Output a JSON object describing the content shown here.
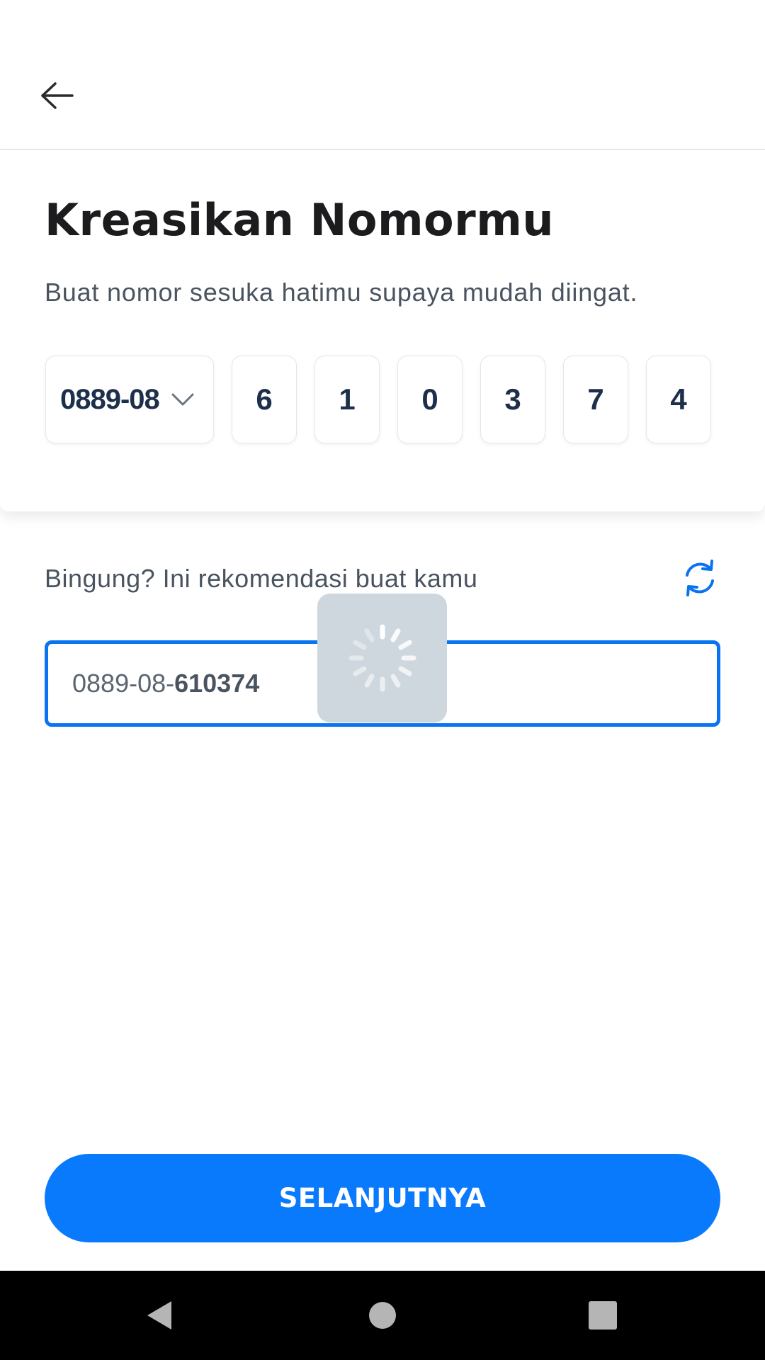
{
  "header": {
    "back_icon": "arrow-left-icon"
  },
  "card": {
    "title": "Kreasikan Nomormu",
    "subtitle": "Buat nomor sesuka hatimu supaya mudah diingat.",
    "prefix": "0889-08",
    "prefix_icon": "chevron-down-icon",
    "digits": [
      "6",
      "1",
      "0",
      "3",
      "7",
      "4"
    ]
  },
  "recommendation": {
    "label": "Bingung? Ini rekomendasi buat kamu",
    "refresh_icon": "refresh-icon",
    "number_prefix": "0889-08-",
    "number_suffix": "610374"
  },
  "loading": {
    "icon": "spinner-icon"
  },
  "actions": {
    "next_label": "SELANJUTNYA"
  },
  "navbar": {
    "back_icon": "nav-back-icon",
    "home_icon": "nav-home-icon",
    "recents_icon": "nav-recents-icon"
  },
  "colors": {
    "primary": "#0a7afd",
    "field_border": "#0a73f0",
    "title_text": "#1c1c1e",
    "digit_text": "#1d2f4a",
    "body_text": "#4a5460",
    "loader_bg": "#cfd7de"
  }
}
